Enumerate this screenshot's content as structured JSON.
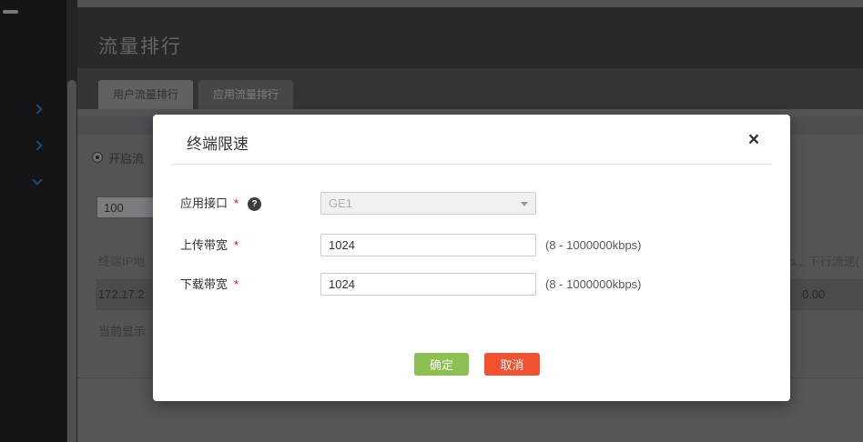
{
  "header": {
    "page_title": "流量排行"
  },
  "tabs": {
    "user": {
      "label": "用户流量排行"
    },
    "app": {
      "label": "应用流量排行"
    }
  },
  "panel": {
    "radio_label": "开启流",
    "count_value": "100",
    "table": {
      "col_ip": "终端IP地",
      "col_right": "b... 下行流速(",
      "row": {
        "ip": "172.17.2",
        "down_value": "0.00"
      }
    },
    "footer_text": "当前显示"
  },
  "modal": {
    "title": "终端限速",
    "close_glyph": "×",
    "help_glyph": "?",
    "fields": [
      {
        "label": "应用接口",
        "required_mark": "*",
        "value": "GE1"
      },
      {
        "label": "上传带宽",
        "required_mark": "*",
        "value": "1024",
        "hint": "(8 - 1000000kbps)"
      },
      {
        "label": "下载带宽",
        "required_mark": "*",
        "value": "1024",
        "hint": "(8 - 1000000kbps)"
      }
    ],
    "ok_label": "确定",
    "cancel_label": "取消",
    "colors": {
      "ok_bg": "#8cc152",
      "cancel_bg": "#f0512e",
      "required": "#e60000"
    }
  }
}
